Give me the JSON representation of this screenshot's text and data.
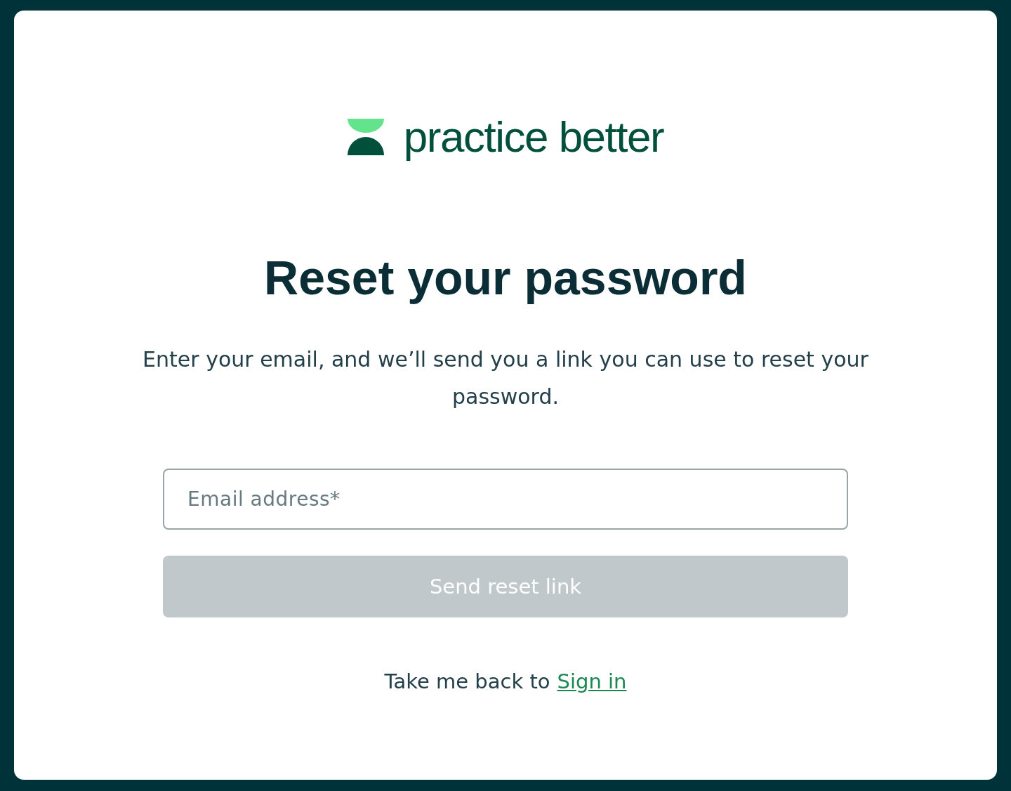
{
  "logo": {
    "text": "practice better"
  },
  "title": "Reset your password",
  "description": "Enter your email, and we’ll send you a link you can use to reset your password.",
  "email_field": {
    "placeholder": "Email address*"
  },
  "submit_button": {
    "label": "Send reset link",
    "disabled": true
  },
  "footer": {
    "text": "Take me back to",
    "link": "Sign in"
  }
}
